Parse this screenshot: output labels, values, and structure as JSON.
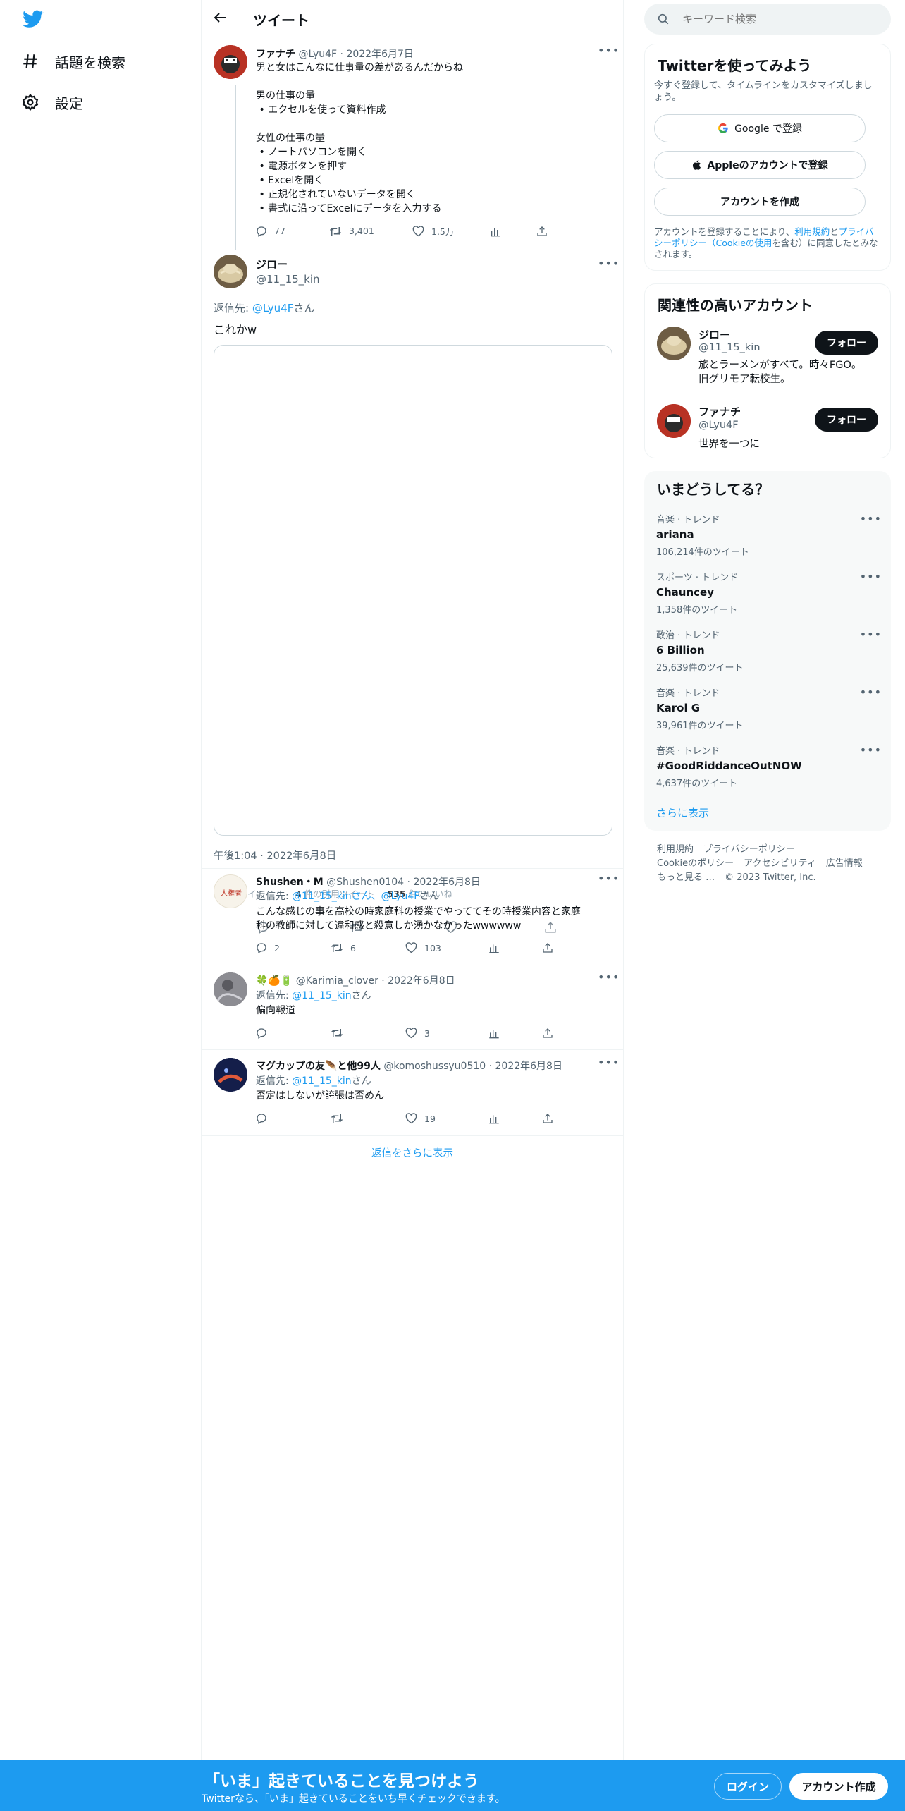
{
  "leftnav": {
    "items": [
      {
        "label": "話題を検索",
        "icon": "hashtag-icon"
      },
      {
        "label": "設定",
        "icon": "gear-icon"
      }
    ]
  },
  "header": {
    "title": "ツイート"
  },
  "main_tweet": {
    "name": "ファナチ",
    "handle": "@Lyu4F",
    "date": "· 2022年6月7日",
    "text": "男と女はこんなに仕事量の差があるんだからね\n\n男の仕事の量\n • エクセルを使って資料作成\n\n女性の仕事の量\n • ノートパソコンを開く\n • 電源ボタンを押す\n • Excelを開く\n • 正規化されていないデータを開く\n • 書式に沿ってExcelにデータを入力する",
    "replies": "77",
    "retweets": "3,401",
    "likes": "1.5万"
  },
  "focus_tweet": {
    "name": "ジロー",
    "handle": "@11_15_kin",
    "reply_prefix": "返信先: ",
    "reply_to": "@Lyu4F",
    "reply_suffix": "さん",
    "text": "これかw",
    "timestamp": "午後1:04 · 2022年6月8日"
  },
  "overlay_ghost": {
    "line1_left": "リツイ",
    "line1_rt": "4",
    "line1_mid": "件の引用ツイート",
    "line1_likes": "535",
    "line1_likes_label": " 件のいいね"
  },
  "replies": [
    {
      "name": "Shushen・M",
      "handle": "@Shushen0104",
      "date": "· 2022年6月8日",
      "reply_prefix": "返信先: ",
      "reply_to": "@11_15_kinさん、@Lyu4F",
      "reply_suffix": "さん",
      "text": "こんな感じの事を高校の時家庭科の授業でやっててその時授業内容と家庭\n科の教師に対して違和感と殺意しか湧かなかったwwwwww",
      "replies": "2",
      "retweets": "6",
      "likes": "103",
      "avatar_label": "人権者"
    },
    {
      "name": "🍀🍊🔋",
      "handle": "@Karimia_clover",
      "date": "· 2022年6月8日",
      "reply_prefix": "返信先: ",
      "reply_to": "@11_15_kin",
      "reply_suffix": "さん",
      "text": "偏向報道",
      "replies": "",
      "retweets": "",
      "likes": "3"
    },
    {
      "name": "マグカップの友🪶と他99人",
      "handle": "@komoshussyu0510",
      "date": "· 2022年6月8日",
      "reply_prefix": "返信先: ",
      "reply_to": "@11_15_kin",
      "reply_suffix": "さん",
      "text": "否定はしないが誇張は否めん",
      "replies": "",
      "retweets": "",
      "likes": "19"
    }
  ],
  "show_more_replies": "返信をさらに表示",
  "search": {
    "placeholder": "キーワード検索"
  },
  "signup_card": {
    "title": "Twitterを使ってみよう",
    "subtitle": "今すぐ登録して、タイムラインをカスタマイズしましょう。",
    "google_label": "Google で登録",
    "apple_label": "Appleのアカウントで登録",
    "create_label": "アカウントを作成",
    "legal_prefix": "アカウントを登録することにより、",
    "legal_terms": "利用規約",
    "legal_and": "と",
    "legal_privacy": "プライバシーポリシー（Cookieの使用",
    "legal_suffix": "を含む）に同意したとみなされます。"
  },
  "related_card": {
    "title": "関連性の高いアカウント",
    "follow_label": "フォロー",
    "accounts": [
      {
        "name": "ジロー",
        "handle": "@11_15_kin",
        "bio": "旅とラーメンがすべて。時々FGO。\n旧グリモア転校生。"
      },
      {
        "name": "ファナチ",
        "handle": "@Lyu4F",
        "bio": "世界を一つに"
      }
    ]
  },
  "trends_card": {
    "title": "いまどうしてる？",
    "show_more": "さらに表示",
    "items": [
      {
        "category": "音楽 · トレンド",
        "name": "ariana",
        "count": "106,214件のツイート"
      },
      {
        "category": "スポーツ · トレンド",
        "name": "Chauncey",
        "count": "1,358件のツイート"
      },
      {
        "category": "政治 · トレンド",
        "name": "6 Billion",
        "count": "25,639件のツイート"
      },
      {
        "category": "音楽 · トレンド",
        "name": "Karol G",
        "count": "39,961件のツイート"
      },
      {
        "category": "音楽 · トレンド",
        "name": "#GoodRiddanceOutNOW",
        "count": "4,637件のツイート"
      }
    ]
  },
  "footer": {
    "links": [
      "利用規約",
      "プライバシーポリシー",
      "Cookieのポリシー",
      "アクセシビリティ",
      "広告情報",
      "もっと見る …"
    ],
    "copyright": "© 2023 Twitter, Inc."
  },
  "bottom_bar": {
    "title": "「いま」起きていることを見つけよう",
    "subtitle": "Twitterなら、「いま」起きていることをいち早くチェックできます。",
    "login_label": "ログイン",
    "signup_label": "アカウント作成"
  },
  "colors": {
    "accent": "#1d9bf0",
    "text": "#0f1419",
    "muted": "#536471",
    "border": "#eff3f4"
  }
}
